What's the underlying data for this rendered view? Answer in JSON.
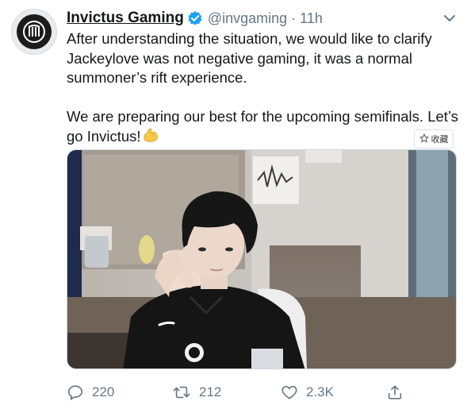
{
  "tweet": {
    "display_name": "Invictus Gaming",
    "handle": "@invgaming",
    "separator": "·",
    "timestamp": "11h",
    "paragraph1": "After understanding the situation, we would like to clarify Jackeylove was not negative gaming, it was a normal summoner’s rift experience.",
    "paragraph2": "We are preparing our best for the upcoming semifinals. Let’s go Invictus!",
    "emoji": "flexed-biceps-emoji",
    "collect_label": "收藏",
    "media_description_icon": "photo"
  },
  "actions": {
    "reply_count": "220",
    "retweet_count": "212",
    "like_count": "2.3K"
  },
  "icons": [
    "verified-badge-icon",
    "chevron-down-icon",
    "star-icon",
    "reply-icon",
    "retweet-icon",
    "heart-icon",
    "share-icon"
  ],
  "colors": {
    "text": "#14171a",
    "secondary": "#657786",
    "verified": "#1da1f2"
  }
}
